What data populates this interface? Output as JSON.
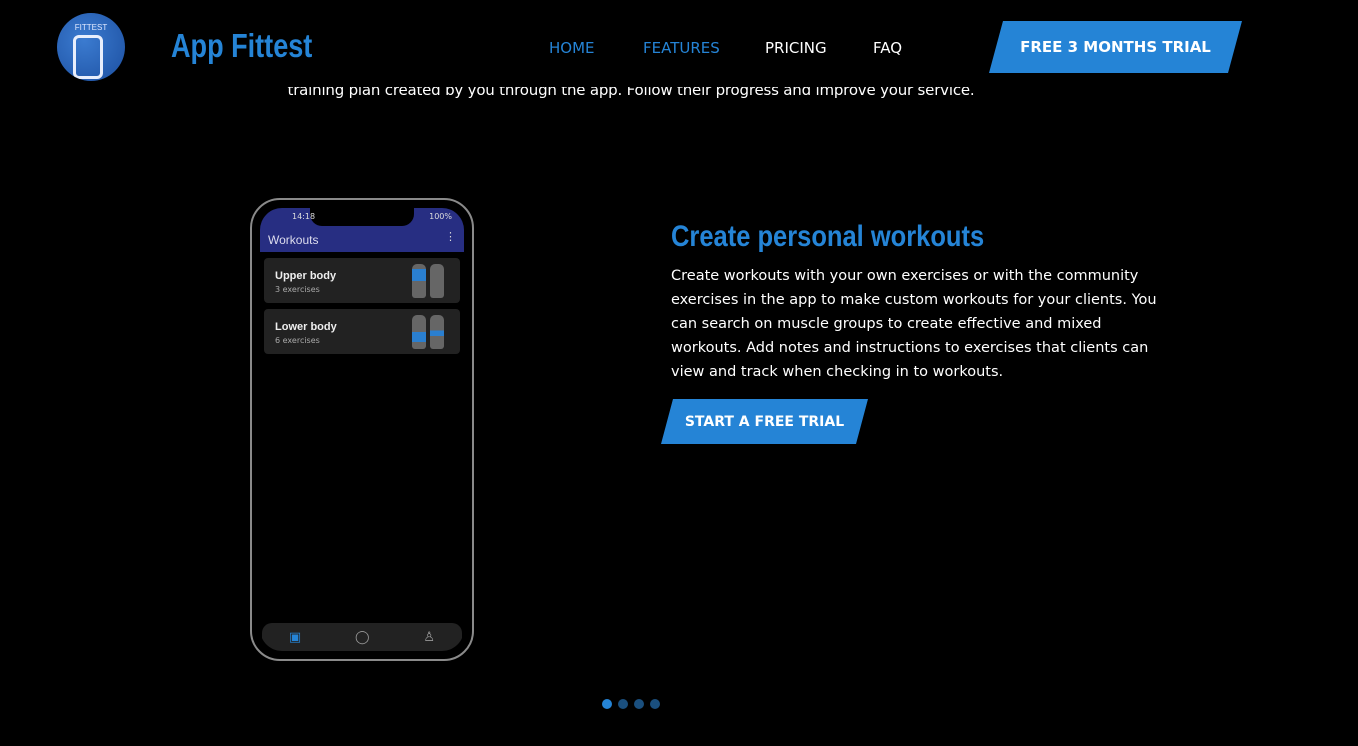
{
  "header": {
    "logo_text": "FITTEST",
    "brand": "App Fittest",
    "nav": [
      {
        "label": "HOME",
        "color": "#2584d6"
      },
      {
        "label": "FEATURES",
        "color": "#2584d6"
      },
      {
        "label": "PRICING",
        "color": "#ffffff"
      },
      {
        "label": "FAQ",
        "color": "#ffffff"
      }
    ],
    "cta": "FREE 3 MONTHS TRIAL"
  },
  "intro_text": "training plan created by you through the app. Follow their progress and improve your service.",
  "phone": {
    "time": "14:18",
    "battery": "100%",
    "title": "Workouts",
    "workouts": [
      {
        "name": "Upper body",
        "count": "3 exercises"
      },
      {
        "name": "Lower body",
        "count": "6 exercises"
      }
    ],
    "tabs": [
      "calendar-icon",
      "chat-icon",
      "profile-icon"
    ]
  },
  "feature": {
    "title": "Create personal workouts",
    "description": "Create workouts with your own exercises or with the community exercises in the app to make custom workouts for your clients. You can search on muscle groups to create effective and mixed workouts. Add notes and instructions to exercises that clients can view and track when checking in to workouts.",
    "cta": "START A FREE TRIAL"
  },
  "carousel": {
    "total": 4,
    "active": 1
  },
  "colors": {
    "accent": "#2584d6",
    "background": "#000000"
  }
}
